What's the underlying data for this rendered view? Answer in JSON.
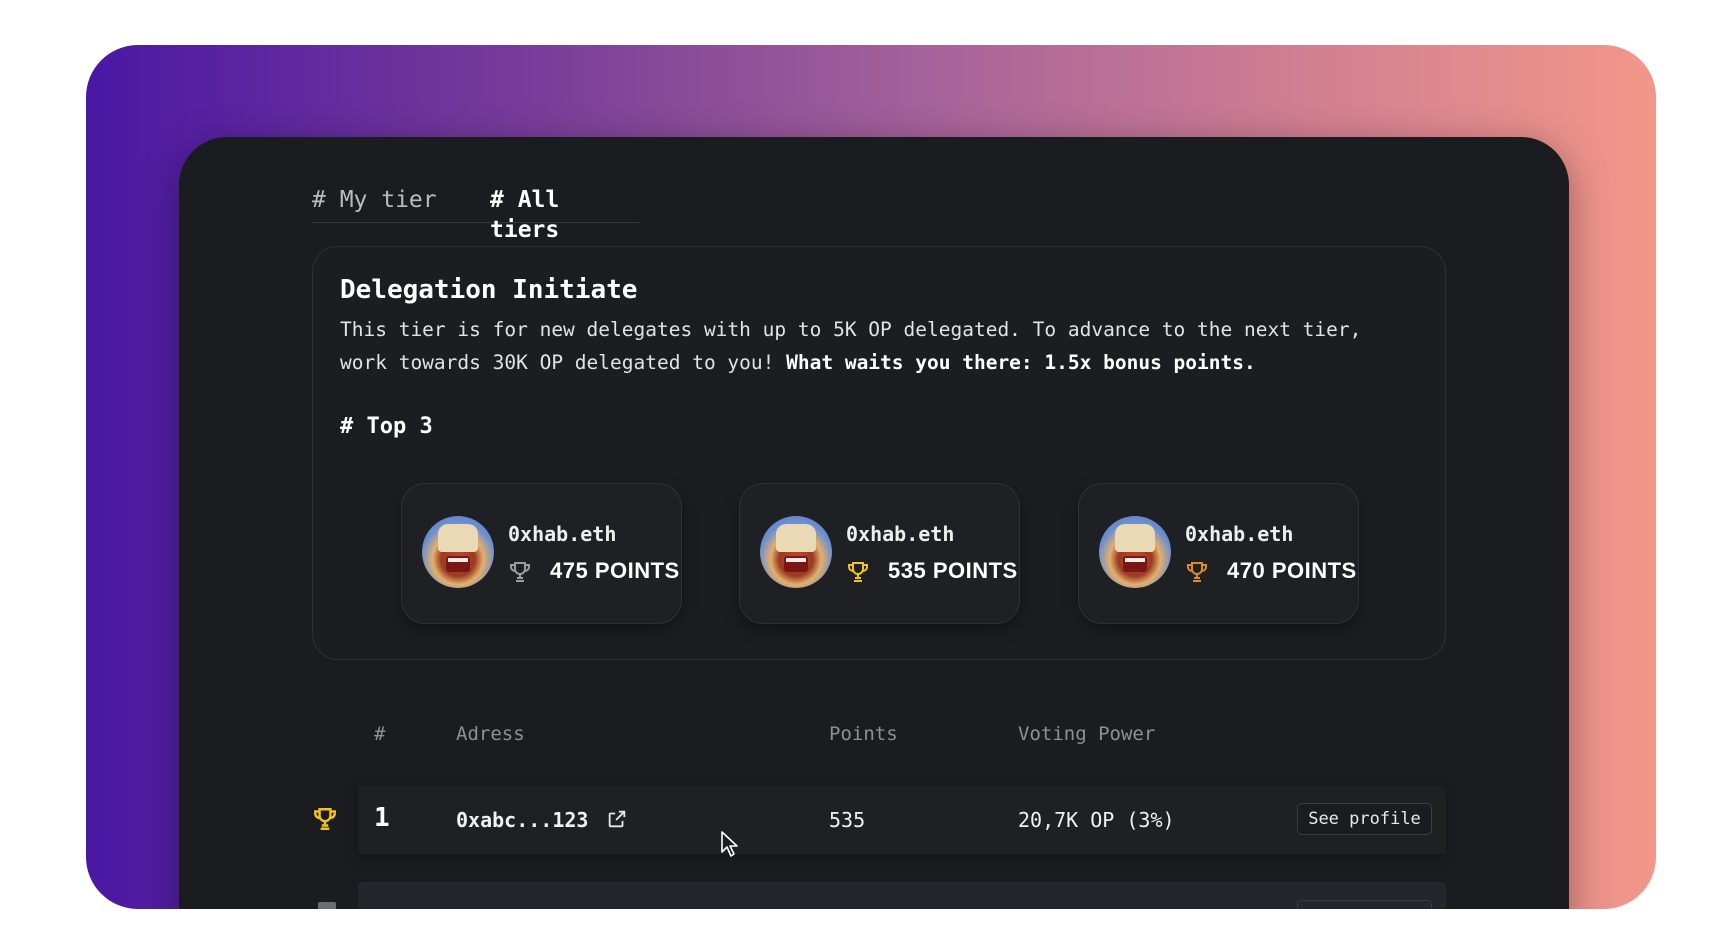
{
  "tabs": [
    {
      "label": "# My tier",
      "active": false
    },
    {
      "label": "# All tiers",
      "active": true
    }
  ],
  "tier": {
    "title": "Delegation Initiate",
    "description": "This tier is for new delegates with up to 5K OP delegated. To advance to the next tier, work towards 30K OP delegated to you! ",
    "description_bold": "What waits you there: 1.5x bonus points."
  },
  "top3": {
    "title": "# Top 3",
    "cards": [
      {
        "name": "0xhab.eth",
        "points": "475 POINTS",
        "trophy_color": "#9a9ca1",
        "trophy_icon": "trophy-silver-icon"
      },
      {
        "name": "0xhab.eth",
        "points": "535 POINTS",
        "trophy_color": "#f2c31b",
        "trophy_icon": "trophy-gold-icon"
      },
      {
        "name": "0xhab.eth",
        "points": "470 POINTS",
        "trophy_color": "#e0892a",
        "trophy_icon": "trophy-bronze-icon"
      }
    ]
  },
  "table": {
    "headers": {
      "rank": "#",
      "address": "Adress",
      "points": "Points",
      "voting_power": "Voting Power"
    },
    "rows": [
      {
        "rank": "1",
        "address": "0xabc...123",
        "points": "535",
        "voting_power": "20,7K OP (3%)",
        "action": "See profile",
        "trophy_color": "#f2c31b"
      }
    ]
  },
  "colors": {
    "background": "#1b1c1f",
    "gold": "#f2c31b",
    "silver": "#9a9ca1",
    "bronze": "#e0892a",
    "gradient_start": "#4a17a4",
    "gradient_end": "#f3978a"
  }
}
